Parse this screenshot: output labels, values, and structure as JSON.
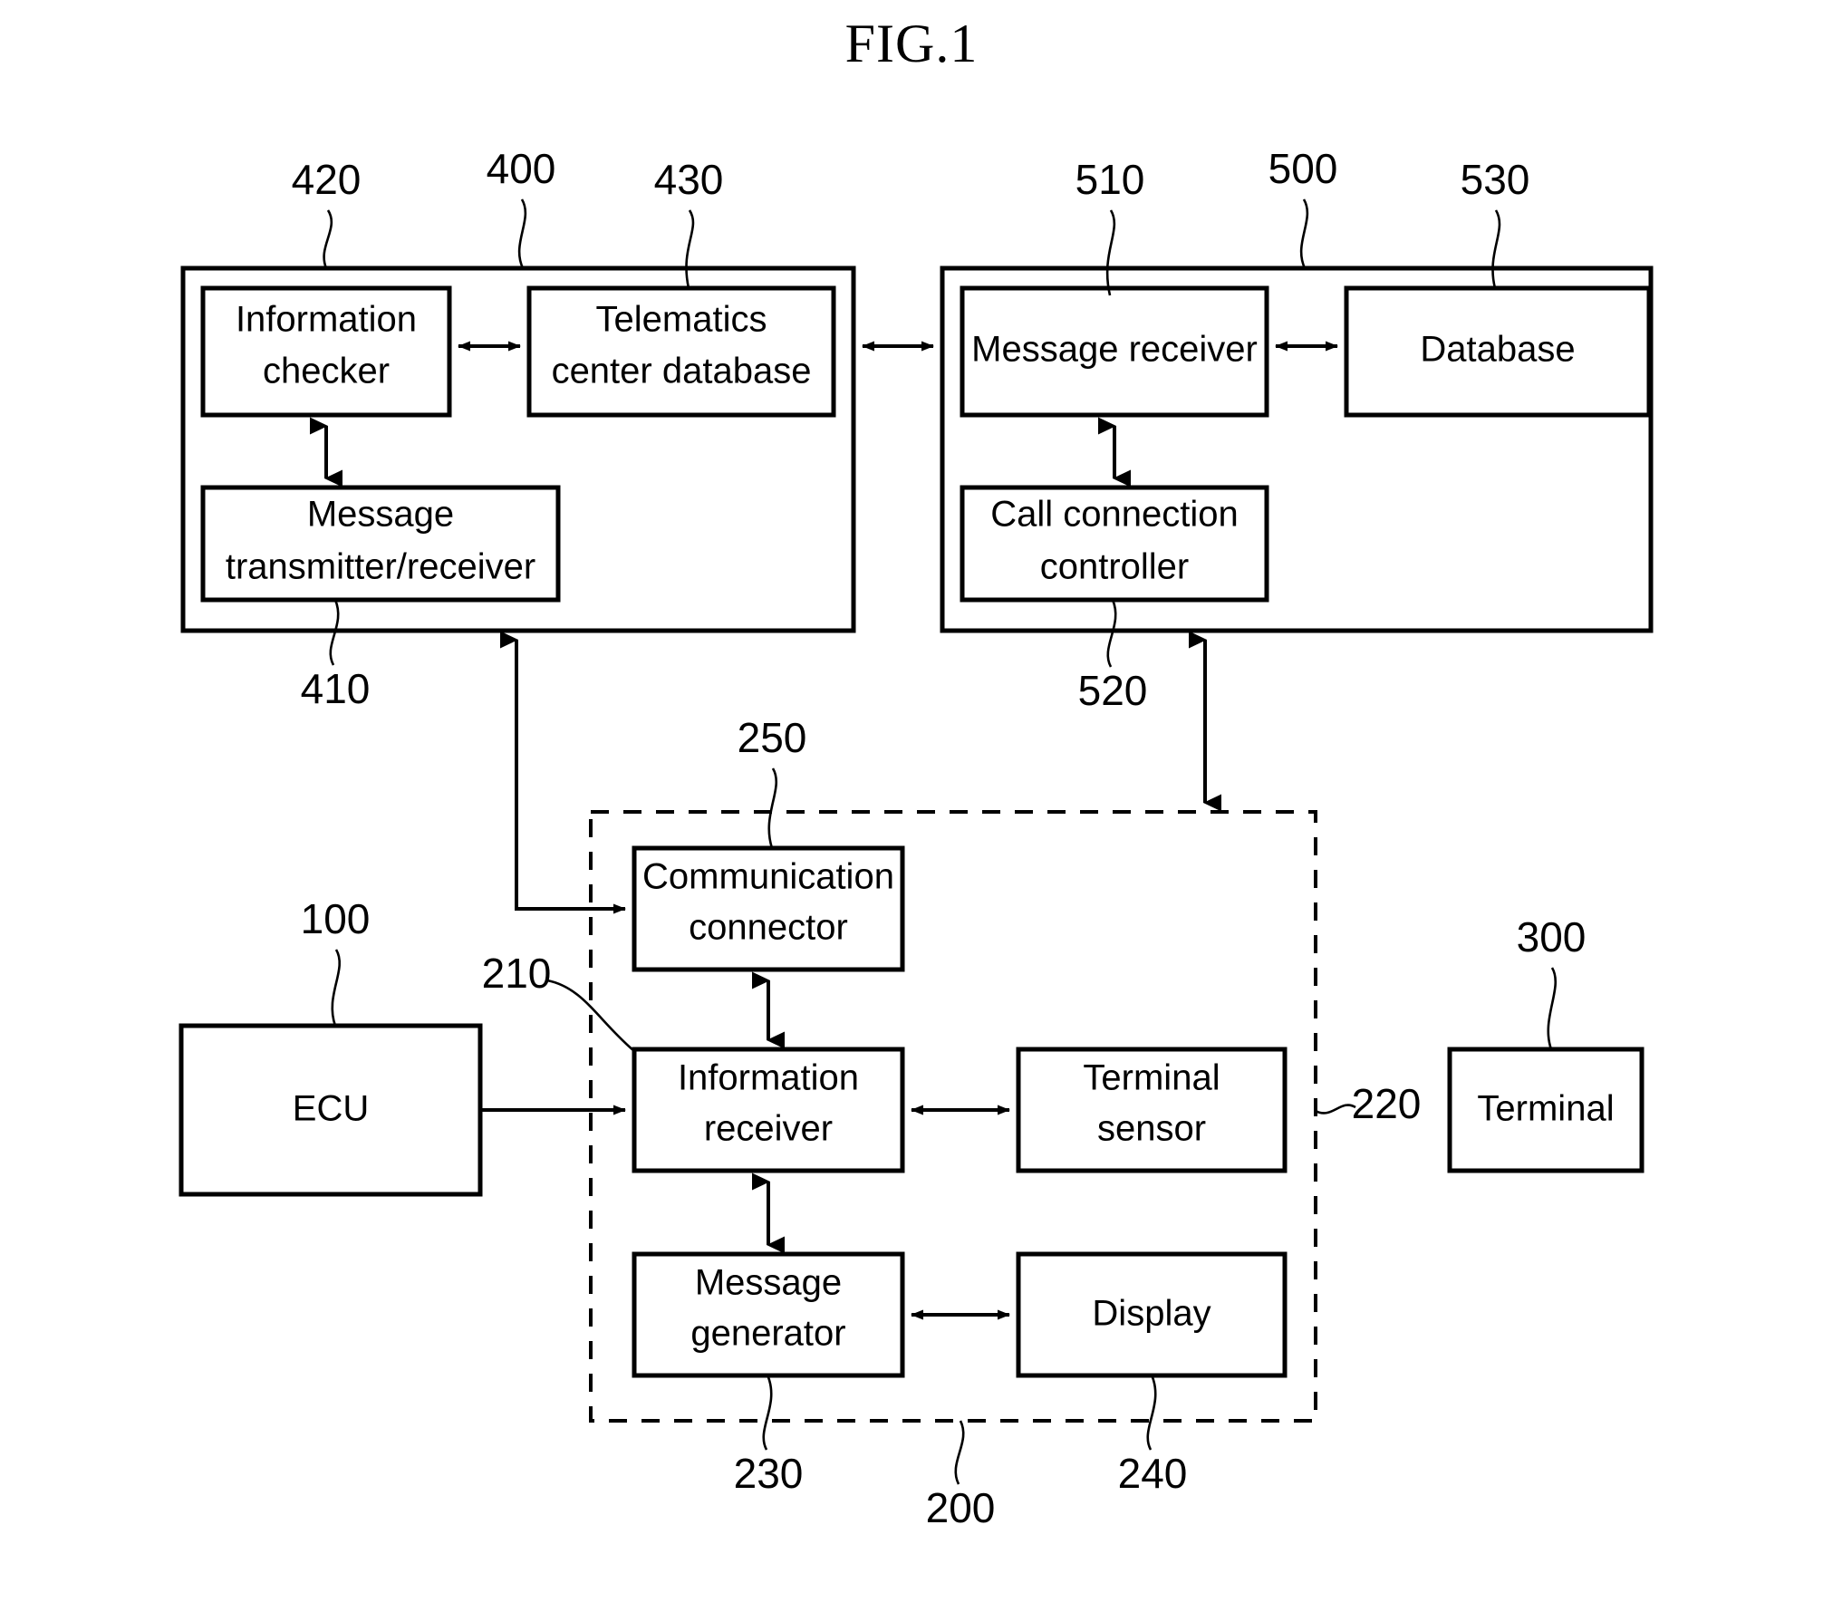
{
  "figure": {
    "title": "FIG.1"
  },
  "blocks": {
    "telematics_center": {
      "ref": "400",
      "children": {
        "information_checker": {
          "ref": "420",
          "line1": "Information",
          "line2": "checker"
        },
        "telematics_center_database": {
          "ref": "430",
          "line1": "Telematics",
          "line2": "center database"
        },
        "message_transmitter_receiver": {
          "ref": "410",
          "line1": "Message",
          "line2": "transmitter/receiver"
        }
      }
    },
    "call_center": {
      "ref": "500",
      "children": {
        "message_receiver": {
          "ref": "510",
          "line1": "Message receiver",
          "line2": ""
        },
        "database": {
          "ref": "530",
          "line1": "Database",
          "line2": ""
        },
        "call_connection_controller": {
          "ref": "520",
          "line1": "Call connection",
          "line2": "controller"
        }
      }
    },
    "vehicle_unit": {
      "ref": "200",
      "children": {
        "communication_connector": {
          "ref": "250",
          "line1": "Communication",
          "line2": "connector"
        },
        "information_receiver": {
          "ref": "210",
          "line1": "Information",
          "line2": "receiver"
        },
        "terminal_sensor": {
          "ref": "220",
          "line1": "Terminal",
          "line2": "sensor"
        },
        "message_generator": {
          "ref": "230",
          "line1": "Message",
          "line2": "generator"
        },
        "display": {
          "ref": "240",
          "line1": "Display",
          "line2": ""
        }
      }
    },
    "ecu": {
      "ref": "100",
      "line1": "ECU",
      "line2": ""
    },
    "terminal": {
      "ref": "300",
      "line1": "Terminal",
      "line2": ""
    }
  },
  "reference_numerals": [
    "420",
    "400",
    "430",
    "510",
    "500",
    "530",
    "410",
    "520",
    "250",
    "100",
    "210",
    "300",
    "220",
    "230",
    "200",
    "240"
  ],
  "colors": {
    "stroke": "#000000",
    "background": "#ffffff"
  }
}
